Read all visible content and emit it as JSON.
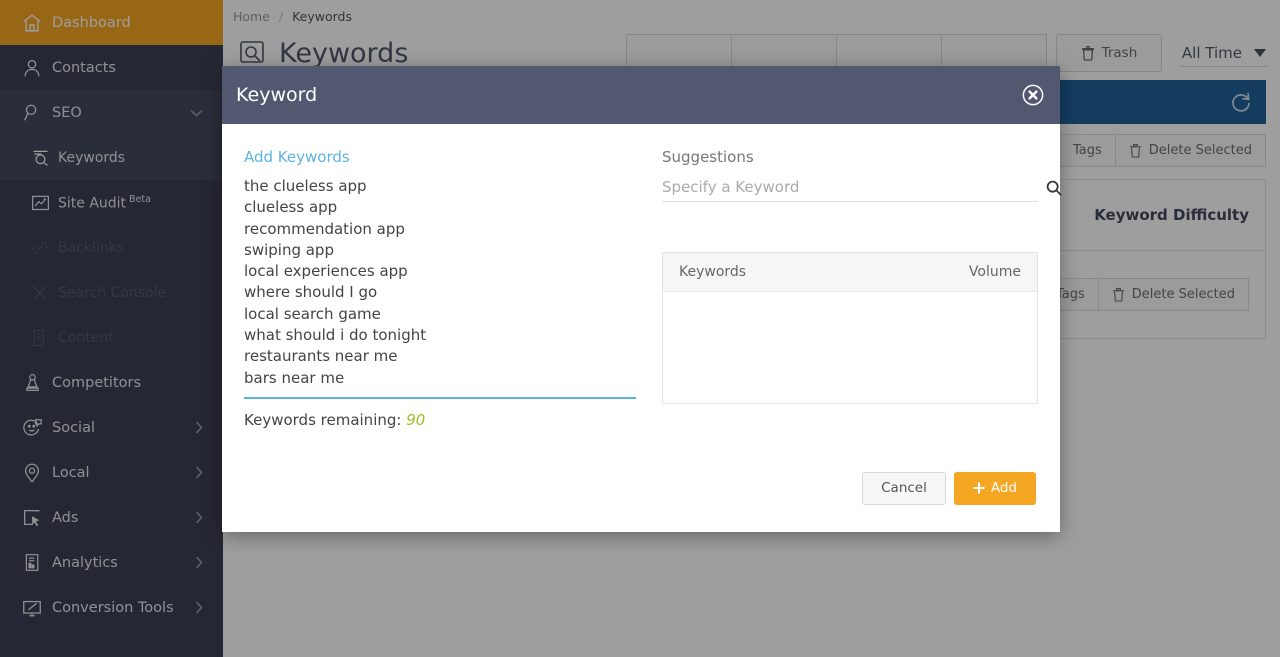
{
  "sidebar": {
    "items": [
      {
        "label": "Dashboard",
        "icon": "home-icon",
        "state": "active",
        "caret": false
      },
      {
        "label": "Contacts",
        "icon": "person-icon",
        "state": "normal",
        "caret": false
      },
      {
        "label": "SEO",
        "icon": "magnifier-icon",
        "state": "expanded",
        "caret": true
      },
      {
        "label": "Keywords",
        "icon": "keyword-search-icon",
        "state": "sub-active",
        "caret": false
      },
      {
        "label": "Site Audit",
        "badge": "Beta",
        "icon": "chart-frame-icon",
        "state": "sub",
        "caret": false
      },
      {
        "label": "Backlinks",
        "icon": "link-icon",
        "state": "sub-disabled",
        "caret": false
      },
      {
        "label": "Search Console",
        "icon": "tools-icon",
        "state": "sub-disabled",
        "caret": false
      },
      {
        "label": "Content",
        "icon": "document-icon",
        "state": "sub-disabled",
        "caret": false
      },
      {
        "label": "Competitors",
        "icon": "chess-pawn-icon",
        "state": "normal",
        "caret": false
      },
      {
        "label": "Social",
        "icon": "smiley-chat-icon",
        "state": "normal",
        "caret": true
      },
      {
        "label": "Local",
        "icon": "map-pin-icon",
        "state": "normal",
        "caret": true
      },
      {
        "label": "Ads",
        "icon": "ad-cursor-icon",
        "state": "normal",
        "caret": true
      },
      {
        "label": "Analytics",
        "icon": "analytics-icon",
        "state": "normal",
        "caret": true
      },
      {
        "label": "Conversion Tools",
        "icon": "monitor-pen-icon",
        "state": "normal",
        "caret": true
      }
    ]
  },
  "page": {
    "breadcrumb": {
      "home": "Home",
      "separator": "/",
      "current": "Keywords"
    },
    "title": "Keywords",
    "title_icon": "keyword-search-icon",
    "toolbar": {
      "trash_label": "Trash",
      "trash_icon": "trash-icon",
      "date_filter_value": "All Time",
      "date_filter_caret": "chevron-down-icon"
    },
    "blue_bar": {
      "refresh_icon": "refresh-icon"
    },
    "actions": {
      "tags_label": "Tags",
      "tags_icon": "tag-icon",
      "delete_selected_label": "Delete Selected",
      "delete_icon": "trash-icon"
    },
    "card_title": "Keyword Difficulty"
  },
  "modal": {
    "title": "Keyword",
    "close_icon": "close-circle-icon",
    "left": {
      "heading": "Add Keywords",
      "keywords": [
        "the clueless app",
        "clueless app",
        "recommendation app",
        "swiping app",
        "local experiences app",
        "where should I go",
        "local search game",
        "what should i do tonight",
        "restaurants near me",
        "bars near me"
      ],
      "remaining_label": "Keywords remaining:",
      "remaining_count": "90"
    },
    "right": {
      "heading": "Suggestions",
      "search_placeholder": "Specify a Keyword",
      "search_value": "",
      "search_icon": "search-icon",
      "table": {
        "columns": [
          "Keywords",
          "Volume"
        ],
        "rows": []
      }
    },
    "footer": {
      "cancel_label": "Cancel",
      "add_label": "Add",
      "add_icon": "plus-icon"
    }
  },
  "colors": {
    "sidebar_bg": "#3c4154",
    "sidebar_sub_bg": "#454a5e",
    "accent_orange": "#f5a623",
    "modal_header": "#535871",
    "link_blue": "#5bb3e4",
    "blue_bar": "#1f6199",
    "remaining_green": "#a6b82a"
  }
}
